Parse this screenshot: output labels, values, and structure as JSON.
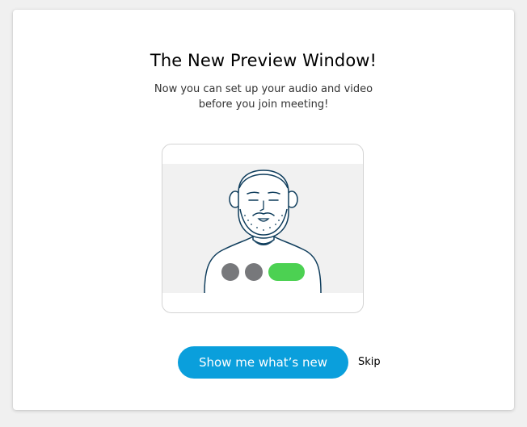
{
  "dialog": {
    "title": "The New Preview Window!",
    "subtitle_line1": "Now you can set up your audio and video",
    "subtitle_line2": "before you join meeting!"
  },
  "illustration": {
    "icon": "person-preview-illustration",
    "controls": [
      "mute-audio-icon",
      "mute-video-icon",
      "join-pill"
    ],
    "colors": {
      "stage_background": "#f1f1f1",
      "outline": "#0f3d5c",
      "control_gray": "#77787b",
      "control_green": "#4cd152"
    }
  },
  "actions": {
    "primary_label": "Show me what’s new",
    "skip_label": "Skip"
  },
  "colors": {
    "accent": "#0a9fdc"
  }
}
